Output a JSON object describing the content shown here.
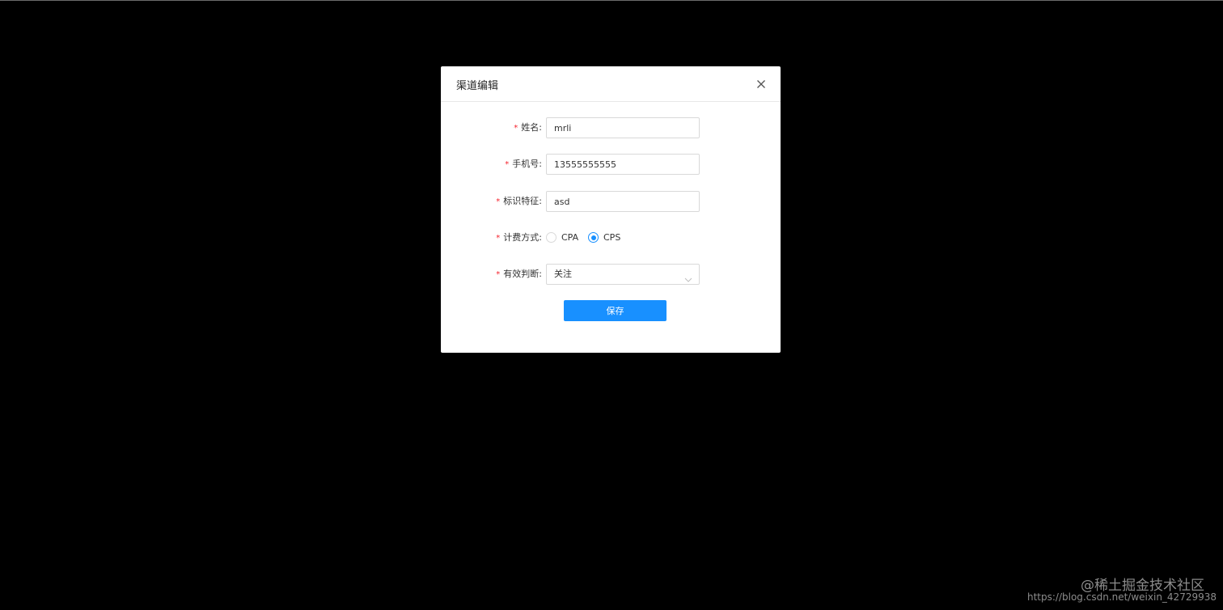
{
  "modal": {
    "title": "渠道编辑",
    "close_icon": "close-icon",
    "fields": {
      "name": {
        "label": "姓名:",
        "value": "mrli",
        "required": true
      },
      "phone": {
        "label": "手机号:",
        "value": "13555555555",
        "required": true
      },
      "identifier": {
        "label": "标识特征:",
        "value": "asd",
        "required": true
      },
      "billing": {
        "label": "计费方式:",
        "required": true,
        "options": [
          {
            "label": "CPA",
            "checked": false
          },
          {
            "label": "CPS",
            "checked": true
          }
        ]
      },
      "validity": {
        "label": "有效判断:",
        "value": "关注",
        "required": true,
        "icon": "chevron-down-icon"
      }
    },
    "save_label": "保存",
    "required_mark": "*"
  },
  "watermark": {
    "title": "@稀土掘金技术社区",
    "url": "https://blog.csdn.net/weixin_42729938"
  },
  "colors": {
    "primary": "#1890ff",
    "required": "#f5222d",
    "backdrop": "#000000"
  }
}
